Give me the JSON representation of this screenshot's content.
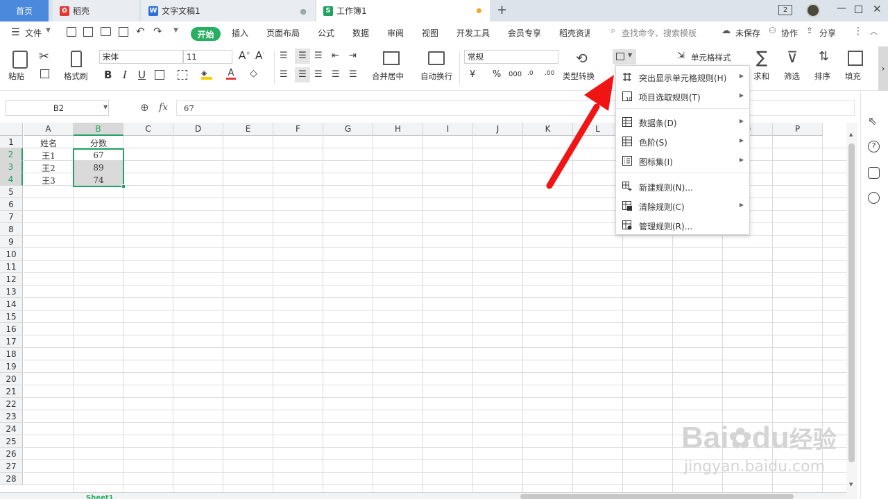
{
  "tabs": [
    {
      "label": "首页"
    },
    {
      "label": "稻壳"
    },
    {
      "label": "文字文稿1"
    },
    {
      "label": "工作簿1"
    }
  ],
  "window": {
    "badge": "2"
  },
  "menu": {
    "file": "文件",
    "start": "开始",
    "items": [
      "插入",
      "页面布局",
      "公式",
      "数据",
      "审阅",
      "视图",
      "开发工具",
      "会员专享",
      "稻壳资源"
    ],
    "search_placeholder": "查找命令、搜索模板",
    "unsaved": "未保存",
    "collab": "协作",
    "share": "分享"
  },
  "ribbon": {
    "paste": "粘贴",
    "format_painter": "格式刷",
    "font_name": "宋体",
    "font_size": "11",
    "merge_center": "合并居中",
    "wrap": "自动换行",
    "number_format": "常规",
    "type_convert": "类型转换",
    "cell_style": "单元格样式",
    "sum": "求和",
    "filter": "筛选",
    "sort": "排序",
    "fill": "填充",
    "currency": "¥",
    "percent": "%",
    "thousands": "000"
  },
  "formula_bar": {
    "cell_ref": "B2",
    "fx": "fx",
    "value": "67"
  },
  "columns": [
    "A",
    "B",
    "C",
    "D",
    "E",
    "F",
    "G",
    "H",
    "I",
    "J",
    "K",
    "L",
    "M",
    "N",
    "O",
    "P"
  ],
  "rows": [
    "1",
    "2",
    "3",
    "4",
    "5",
    "6",
    "7",
    "8",
    "9",
    "10",
    "11",
    "12",
    "13",
    "14",
    "15",
    "16",
    "17",
    "18",
    "19",
    "20",
    "21",
    "22",
    "23",
    "24",
    "25",
    "26",
    "27",
    "28"
  ],
  "cells": {
    "A1": "姓名",
    "B1": "分数",
    "A2": "王1",
    "B2": "67",
    "A3": "王2",
    "B3": "89",
    "A4": "王3",
    "B4": "74"
  },
  "dropdown": {
    "items": [
      {
        "label": "突出显示单元格规则(H)",
        "icon": "highlight-rules-icon",
        "submenu": true
      },
      {
        "label": "项目选取规则(T)",
        "icon": "top-bottom-rules-icon",
        "submenu": true
      },
      {
        "label": "数据条(D)",
        "icon": "data-bar-icon",
        "submenu": true
      },
      {
        "label": "色阶(S)",
        "icon": "color-scale-icon",
        "submenu": true
      },
      {
        "label": "图标集(I)",
        "icon": "icon-set-icon",
        "submenu": true
      },
      {
        "label": "新建规则(N)...",
        "icon": "new-rule-icon",
        "submenu": false
      },
      {
        "label": "清除规则(C)",
        "icon": "clear-rules-icon",
        "submenu": true
      },
      {
        "label": "管理规则(R)...",
        "icon": "manage-rules-icon",
        "submenu": false
      }
    ]
  },
  "sheet": {
    "name": "Sheet1"
  },
  "watermark": {
    "brand": "Bai",
    "mid": "du",
    "cn": "经验",
    "url": "jingyan.baidu.com"
  },
  "colors": {
    "accent_green": "#27ae60",
    "selection_border": "#21a366",
    "arrow_red": "#f01414",
    "tab_blue": "#4a89dc"
  }
}
